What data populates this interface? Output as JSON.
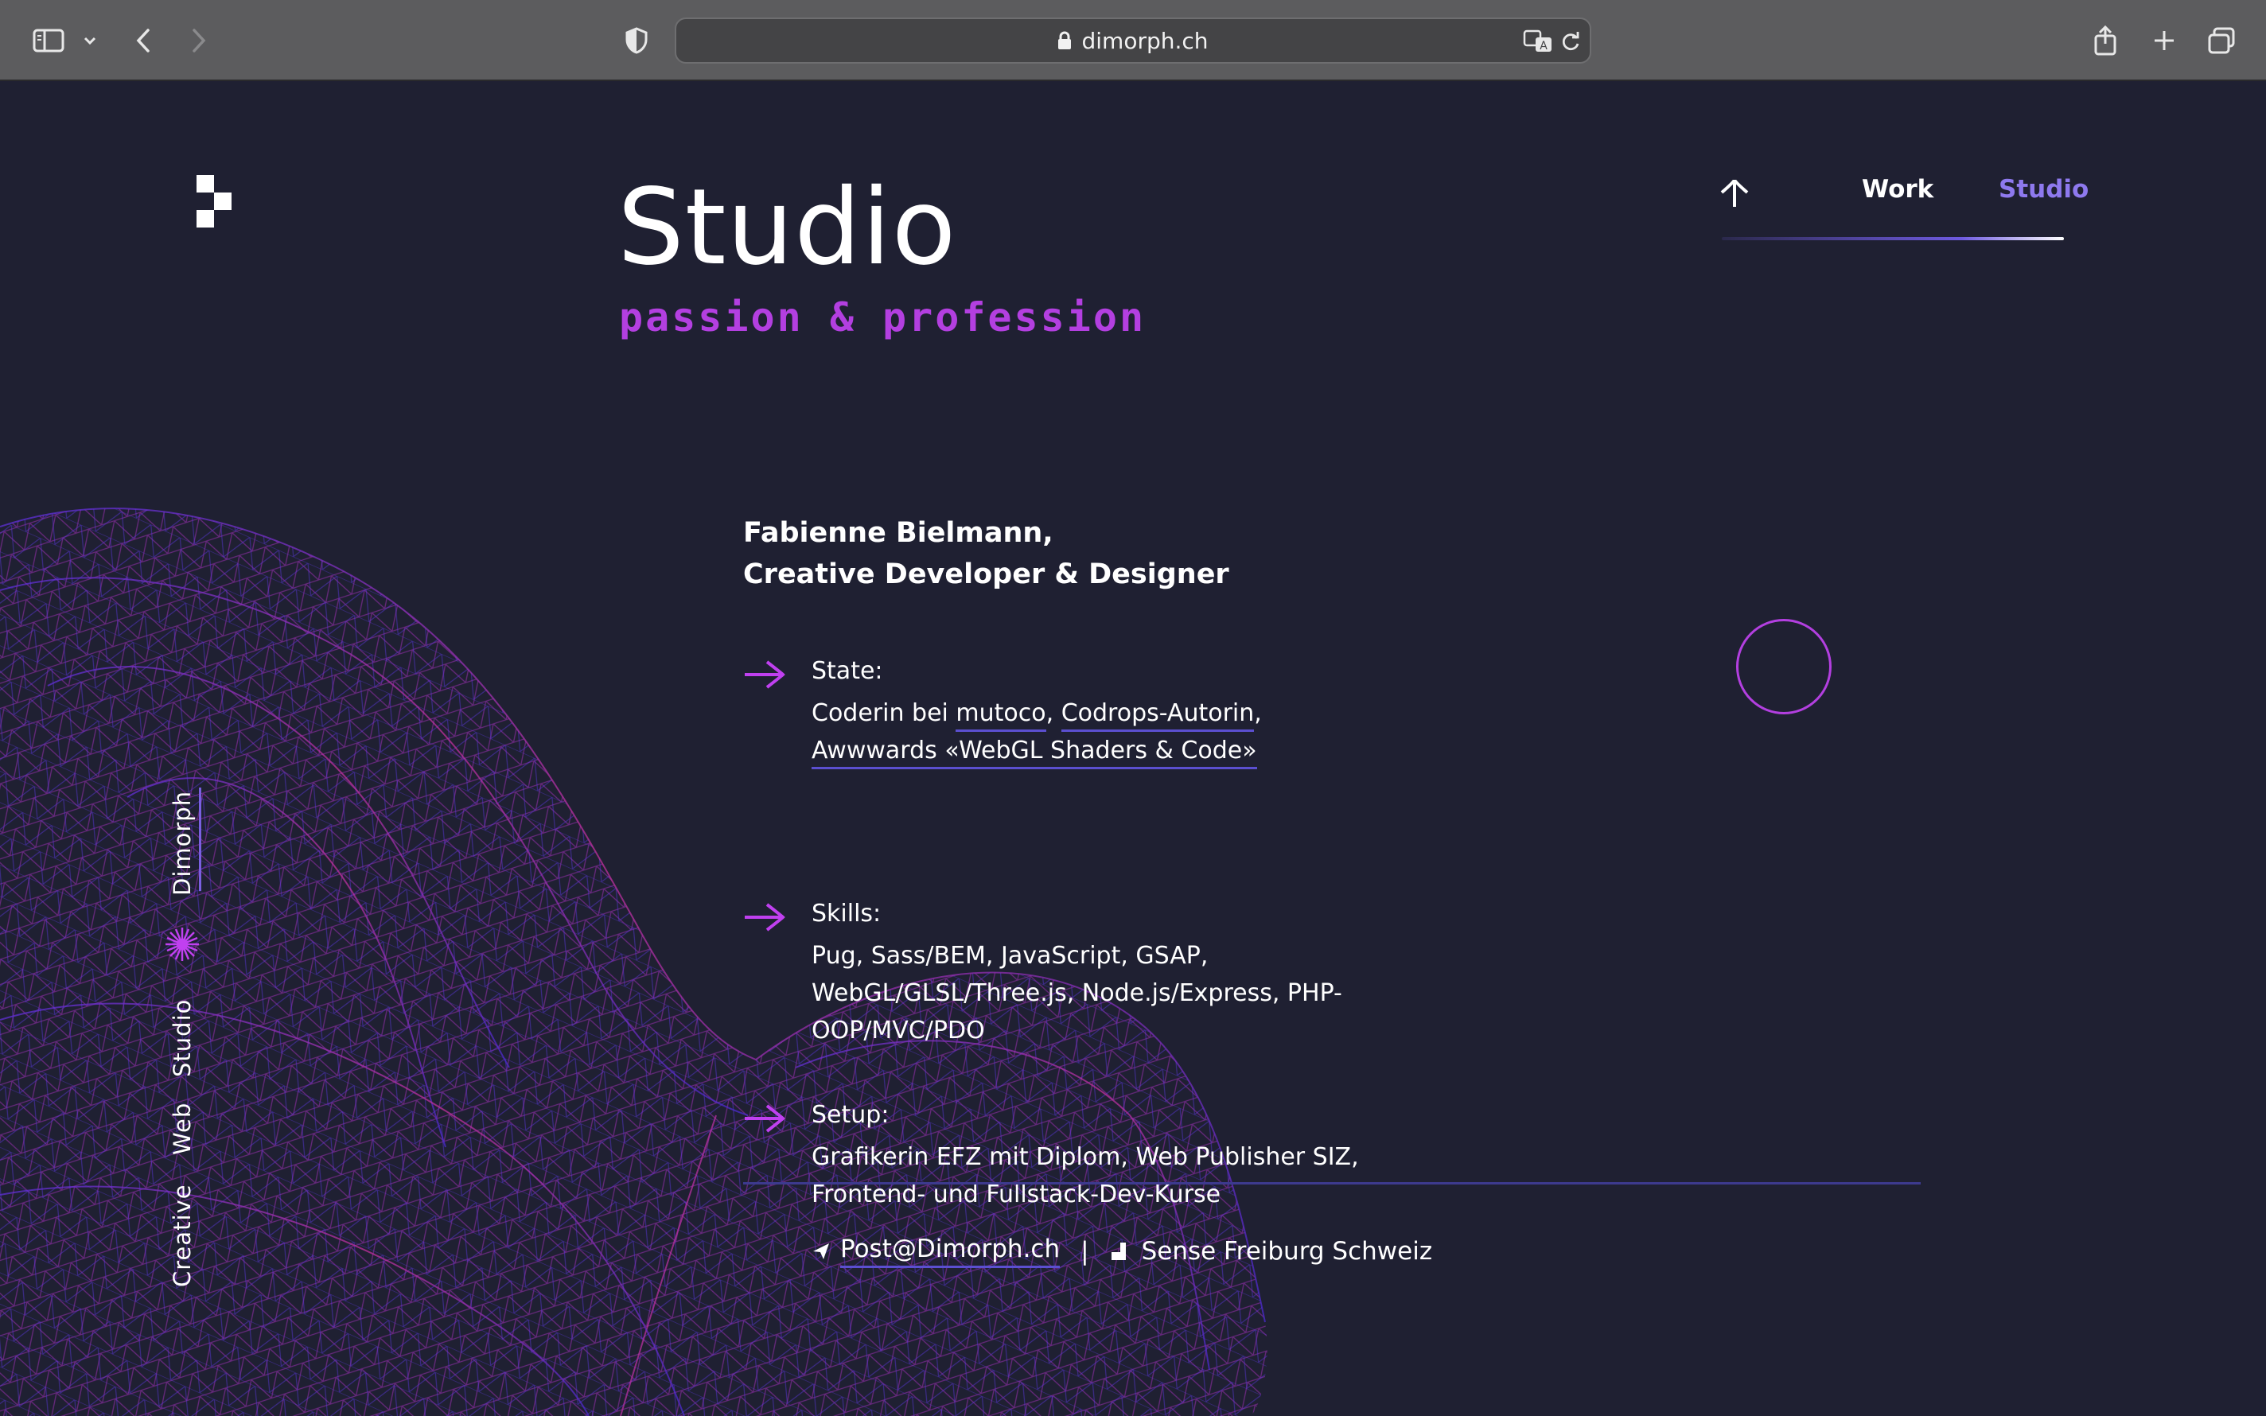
{
  "browser": {
    "url_host": "dimorph.ch",
    "icons": [
      "sidebar-icon",
      "chevron-down-icon",
      "back-icon",
      "forward-icon",
      "privacy-shield-icon",
      "lock-icon",
      "translate-icon",
      "reload-icon",
      "share-icon",
      "new-tab-icon",
      "tab-overview-icon"
    ]
  },
  "header": {
    "title": "Studio",
    "subtitle": "passion & profession"
  },
  "nav": {
    "items": [
      {
        "label": "Work",
        "active": false
      },
      {
        "label": "Studio",
        "active": true
      }
    ]
  },
  "side": {
    "words": [
      "Creative",
      "Web",
      "Studio",
      "Dimorph"
    ]
  },
  "person": {
    "line1": "Fabienne Bielmann,",
    "line2": "Creative Developer & Designer"
  },
  "state": {
    "label": "State:",
    "prefix": "Coderin bei",
    "link1": "mutoco",
    "comma1": ",",
    "link2": "Codrops-Autorin",
    "comma2": ",",
    "link3": "Awwwards «WebGL Shaders & Code»"
  },
  "skills": {
    "label": "Skills:",
    "line1": "Pug, Sass/BEM, JavaScript, GSAP,",
    "line2": "WebGL/GLSL/Three.js, Node.js/Express, PHP-",
    "line3": "OOP/MVC/PDO"
  },
  "setup": {
    "label": "Setup:",
    "line1": "Grafikerin EFZ mit Diplom, Web Publisher SIZ,",
    "line2": "Frontend- und Fullstack-Dev-Kurse"
  },
  "contact": {
    "email": "Post@Dimorph.ch",
    "separator": "|",
    "location": "Sense Freiburg Schweiz"
  },
  "colors": {
    "background": "#1f2032",
    "accent_magenta": "#b33fe0",
    "accent_violet": "#8e79ee",
    "underline": "#5b4fd0"
  }
}
